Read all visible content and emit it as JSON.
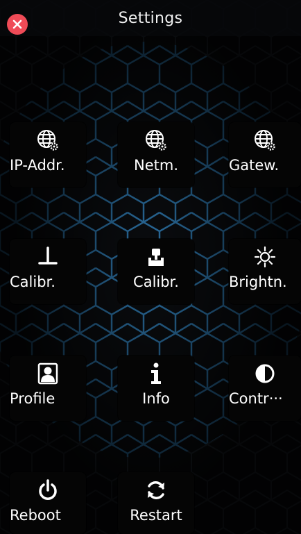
{
  "header": {
    "title": "Settings"
  },
  "tiles": [
    {
      "label": "IP-Addr."
    },
    {
      "label": "Netm."
    },
    {
      "label": "Gatew."
    },
    {
      "label": "Calibr."
    },
    {
      "label": "Calibr."
    },
    {
      "label": "Brightn."
    },
    {
      "label": "Profile"
    },
    {
      "label": "Info"
    },
    {
      "label": "Contr···"
    },
    {
      "label": "Reboot"
    },
    {
      "label": "Restart"
    }
  ],
  "colors": {
    "accent": "#ef4b57",
    "tile_bg": "#050505",
    "hex_glow": "#2f86c6"
  }
}
